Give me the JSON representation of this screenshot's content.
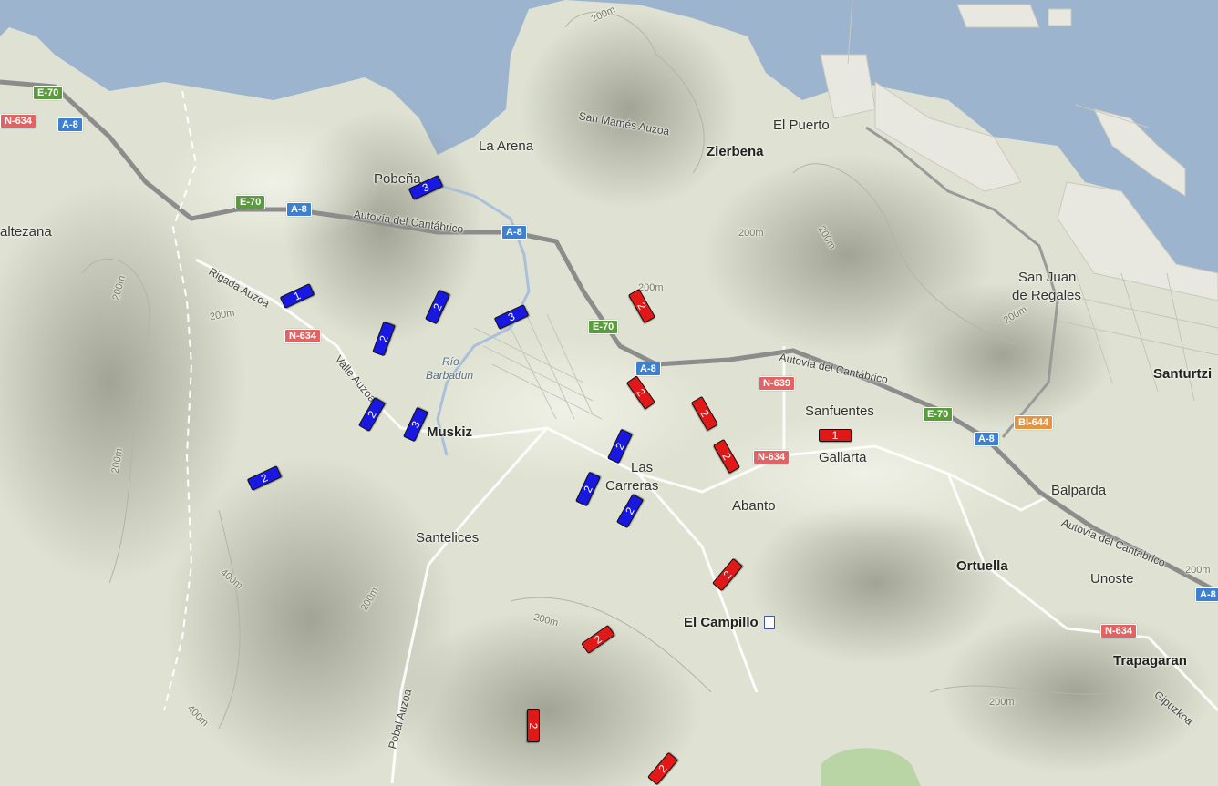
{
  "colors": {
    "sea": "#9db4ce",
    "land": "#dfe2d2",
    "motorway": "#8c8c8c",
    "e_road_shield": "#5a9c3c",
    "a_road_shield": "#3d7fd0",
    "n_road_shield": "#e06464",
    "bi_road_shield": "#e8943c",
    "marker_blue": "#1818e0",
    "marker_red": "#e01818"
  },
  "towns": [
    {
      "name": "Pobeña",
      "style": "town"
    },
    {
      "name": "La Arena",
      "style": "town"
    },
    {
      "name": "Zierbena",
      "style": "town-b"
    },
    {
      "name": "El Puerto",
      "style": "town"
    },
    {
      "name": "San Juan",
      "style": "town"
    },
    {
      "name": "de Regales",
      "style": "town"
    },
    {
      "name": "Santurtzi",
      "style": "town-b"
    },
    {
      "name": "altezana",
      "style": "town"
    },
    {
      "name": "Muskiz",
      "style": "town-b"
    },
    {
      "name": "Las",
      "style": "town"
    },
    {
      "name": "Carreras",
      "style": "town"
    },
    {
      "name": "Sanfuentes",
      "style": "town"
    },
    {
      "name": "Gallarta",
      "style": "town"
    },
    {
      "name": "Abanto",
      "style": "town"
    },
    {
      "name": "Balparda",
      "style": "town"
    },
    {
      "name": "Santelices",
      "style": "town"
    },
    {
      "name": "Ortuella",
      "style": "town-b"
    },
    {
      "name": "Unoste",
      "style": "town"
    },
    {
      "name": "El Campillo",
      "style": "town-b"
    },
    {
      "name": "Trapagaran",
      "style": "town-b"
    }
  ],
  "road_names": [
    "San Mamés Auzoa",
    "Autovía del Cantábrico",
    "Rigada Auzoa",
    "Valle Auzoa",
    "Autovía del Cantábrico",
    "Autovía del Cantábrico",
    "Pobal Auzoa",
    "Gipuzkoa"
  ],
  "river_names": [
    "Río",
    "Barbadun"
  ],
  "contour_labels": [
    "200m",
    "200m",
    "200m",
    "200m",
    "200m",
    "200m",
    "200m",
    "400m",
    "200m",
    "200m",
    "400m",
    "200m",
    "200m",
    "200m"
  ],
  "road_shields": [
    {
      "label": "E-70",
      "kind": "e_road_shield"
    },
    {
      "label": "N-634",
      "kind": "n_road_shield"
    },
    {
      "label": "A-8",
      "kind": "a_road_shield"
    },
    {
      "label": "E-70",
      "kind": "e_road_shield"
    },
    {
      "label": "A-8",
      "kind": "a_road_shield"
    },
    {
      "label": "A-8",
      "kind": "a_road_shield"
    },
    {
      "label": "N-634",
      "kind": "n_road_shield"
    },
    {
      "label": "E-70",
      "kind": "e_road_shield"
    },
    {
      "label": "A-8",
      "kind": "a_road_shield"
    },
    {
      "label": "N-639",
      "kind": "n_road_shield"
    },
    {
      "label": "N-634",
      "kind": "n_road_shield"
    },
    {
      "label": "E-70",
      "kind": "e_road_shield"
    },
    {
      "label": "A-8",
      "kind": "a_road_shield"
    },
    {
      "label": "BI-644",
      "kind": "bi_road_shield"
    },
    {
      "label": "N-634",
      "kind": "n_road_shield"
    },
    {
      "label": "A-8",
      "kind": "a_road_shield"
    }
  ],
  "markers": [
    {
      "label": "3",
      "color": "blue"
    },
    {
      "label": "1",
      "color": "blue"
    },
    {
      "label": "2",
      "color": "blue"
    },
    {
      "label": "3",
      "color": "blue"
    },
    {
      "label": "2",
      "color": "blue"
    },
    {
      "label": "2",
      "color": "blue"
    },
    {
      "label": "3",
      "color": "blue"
    },
    {
      "label": "2",
      "color": "blue"
    },
    {
      "label": "2",
      "color": "blue"
    },
    {
      "label": "2",
      "color": "blue"
    },
    {
      "label": "2",
      "color": "blue"
    },
    {
      "label": "2",
      "color": "red"
    },
    {
      "label": "2",
      "color": "red"
    },
    {
      "label": "2",
      "color": "red"
    },
    {
      "label": "1",
      "color": "red"
    },
    {
      "label": "2",
      "color": "red"
    },
    {
      "label": "2",
      "color": "red"
    },
    {
      "label": "2",
      "color": "red"
    },
    {
      "label": "2",
      "color": "red"
    },
    {
      "label": "2",
      "color": "red"
    }
  ]
}
